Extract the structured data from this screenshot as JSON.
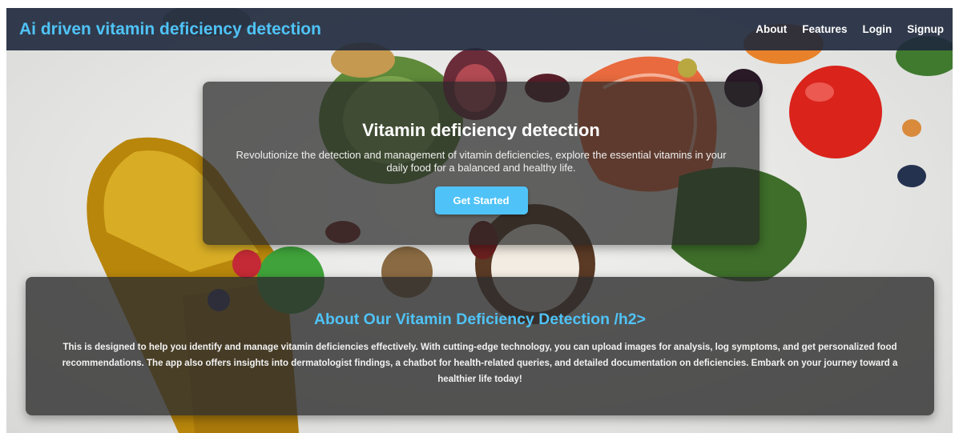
{
  "navbar": {
    "brand": "Ai driven vitamin deficiency detection",
    "links": [
      "About",
      "Features",
      "Login",
      "Signup"
    ]
  },
  "hero": {
    "title": "Vitamin deficiency detection",
    "text": "Revolutionize the detection and management of vitamin deficiencies, explore the essential vitamins in your daily food for a balanced and healthy life.",
    "button_label": "Get Started"
  },
  "about": {
    "title": "About Our Vitamin Deficiency Detection /h2>",
    "text": "This is designed to help you identify and manage vitamin deficiencies effectively. With cutting-edge technology, you can upload images for analysis, log symptoms, and get personalized food recommendations. The app also offers insights into dermatologist findings, a chatbot for health-related queries, and detailed documentation on deficiencies. Embark on your journey toward a healthier life today!"
  },
  "colors": {
    "accent": "#4fc3f7",
    "navbar_bg": "#1e283c",
    "card_bg": "#282828"
  },
  "background_image": "vitamin-rich-foods-and-capsule"
}
